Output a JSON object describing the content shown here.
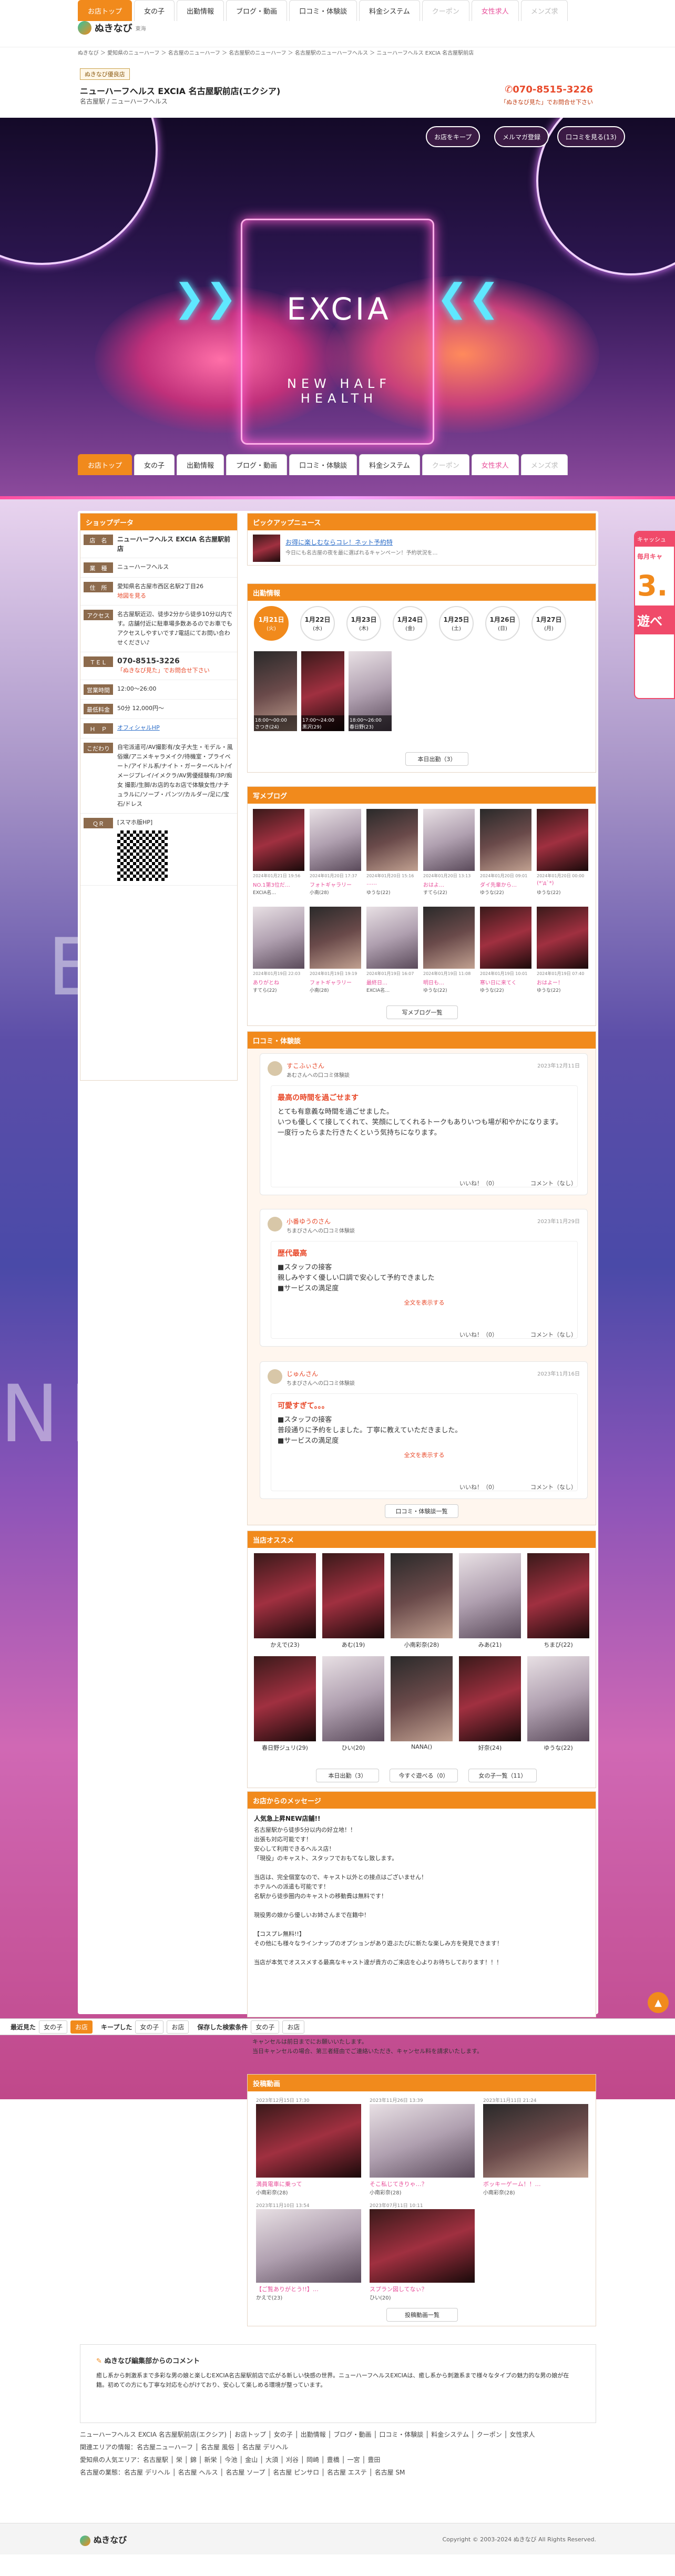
{
  "top_nav": {
    "tabs": [
      {
        "label": "お店トップ",
        "active": true
      },
      {
        "label": "女の子"
      },
      {
        "label": "出勤情報"
      },
      {
        "label": "ブログ・動画"
      },
      {
        "label": "口コミ・体験談"
      },
      {
        "label": "料金システム"
      },
      {
        "label": "クーポン",
        "dim": true
      },
      {
        "label": "女性求人",
        "pink": true
      },
      {
        "label": "メンズ求",
        "dim": true
      }
    ]
  },
  "site": {
    "logo": "ぬきなび",
    "area": "東海"
  },
  "breadcrumb": "ぬきなび ＞ 愛知県のニューハーフ ＞ 名古屋のニューハーフ ＞ 名古屋駅のニューハーフ ＞ 名古屋駅のニューハーフヘルス ＞ ニューハーフヘルス EXCIA 名古屋駅前店",
  "shop_header": {
    "badge": "ぬきなび優良店",
    "name": "ニューハーフヘルス EXCIA 名古屋駅前店(エクシア)",
    "sub": "名古屋駅 / ニューハーフヘルス",
    "phone": "070-8515-3226",
    "phone_note": "「ぬきなび見た」でお問合せ下さい"
  },
  "hero": {
    "logo": "EXCIA",
    "tagline": "NEW HALF HEALTH",
    "buttons": [
      "お店をキープ",
      "メルマガ登録",
      "口コミを見る(13)"
    ]
  },
  "shop_data": {
    "title": "ショップデータ",
    "rows": [
      {
        "label": "店　名",
        "value": "ニューハーフヘルス EXCIA 名古屋駅前店"
      },
      {
        "label": "業　種",
        "value": "ニューハーフヘルス"
      },
      {
        "label": "住　所",
        "value": "愛知県名古屋市西区名駅2丁目26"
      },
      {
        "label": "アクセス",
        "value": "名古屋駅近辺、徒歩2分から徒歩10分以内です。店舗付近に駐車場多数あるのでお車でもアクセスしやすいです♪電話にてお問い合わせください♪"
      },
      {
        "label": "ＴＥＬ",
        "value": "070-8515-3226"
      },
      {
        "label": "営業時間",
        "value": "12:00〜26:00"
      },
      {
        "label": "最低料金",
        "value": "50分 12,000円〜"
      },
      {
        "label": "Ｈ　Ｐ",
        "value": "オフィシャルHP"
      },
      {
        "label": "こだわり",
        "value": "自宅派遣可/AV撮影有/女子大生・モデル・風俗嬢/アニメキャラメイク/待機室・プライベート/アイドル系/ナイト・ガーターベルト/イメージプレイ/イメクラ/AV男優経験有/3P/痴女 撮影/生脚/お店的なお店で体験女性/ナチュラルに/ソープ・パンツ/カルダー/足に/宝石/ドレス"
      },
      {
        "label": "ＱＲ",
        "value": "[スマホ版HP]"
      }
    ],
    "map_link": "地図を見る",
    "phone_hint": "「ぬきなび見た」でお問合せ下さい"
  },
  "pickup": {
    "title": "ピックアップニュース",
    "text": "お得に楽しむならコレ！ネット予約特",
    "sub": "今日にも名古屋の夜を最に選ばれるキャンペーン！予約状況を…"
  },
  "schedule": {
    "title": "出勤情報",
    "dates": [
      {
        "day": "1月21日",
        "week": "(火)",
        "on": true
      },
      {
        "day": "1月22日",
        "week": "(水)"
      },
      {
        "day": "1月23日",
        "week": "(木)"
      },
      {
        "day": "1月24日",
        "week": "(金)"
      },
      {
        "day": "1月25日",
        "week": "(土)"
      },
      {
        "day": "1月26日",
        "week": "(日)"
      },
      {
        "day": "1月27日",
        "week": "(月)"
      }
    ],
    "cards": [
      {
        "time": "18:00〜00:00",
        "name": "さつき(24)"
      },
      {
        "time": "17:00〜24:00",
        "name": "黒沢(29)"
      },
      {
        "time": "18:00〜26:00",
        "name": "春日野(23)"
      }
    ],
    "more": "本日出勤（3）"
  },
  "blog": {
    "title": "写メブログ",
    "posts": [
      {
        "date": "2024年01月21日 19:56",
        "title": "NO.1第3位だ…",
        "author": "EXCIA名…"
      },
      {
        "date": "2024年01月20日 17:37",
        "title": "フォトギャラリー",
        "author": "小南(28) "
      },
      {
        "date": "2024年01月20日 15:16",
        "title": "……",
        "author": "ゆうな(22)"
      },
      {
        "date": "2024年01月20日 13:13",
        "title": "おはよ…",
        "author": "すてら(22)"
      },
      {
        "date": "2024年01月20日 09:01",
        "title": "ダイ先輩から…",
        "author": "ゆうな(22)"
      },
      {
        "date": "2024年01月20日 00:00",
        "title": "(*'д`*)",
        "author": "ゆうな(22)"
      },
      {
        "date": "2024年01月19日 22:03",
        "title": "ありがとね",
        "author": "すてら(22)"
      },
      {
        "date": "2024年01月19日 19:19",
        "title": "フォトギャラリー",
        "author": "小南(28)"
      },
      {
        "date": "2024年01月19日 16:07",
        "title": "最終日…",
        "author": "EXCIA名…"
      },
      {
        "date": "2024年01月19日 11:08",
        "title": "明日も…",
        "author": "ゆうな(22)"
      },
      {
        "date": "2024年01月19日 10:01",
        "title": "寒い日に来てく",
        "author": "ゆうな(22)"
      },
      {
        "date": "2024年01月19日 07:40",
        "title": "おはよー！",
        "author": "ゆうな(22)"
      }
    ],
    "more": "写メブログ一覧"
  },
  "reviews": {
    "title": "口コミ・体験談",
    "items": [
      {
        "user": "すこふぃさん",
        "target": "あむさんへの口コミ体験談",
        "date": "2023年12月11日",
        "heading": "最高の時間を過ごせます",
        "body": "とても有意義な時間を過ごせました。\nいつも優しくて接してくれて、笑顔にしてくれるトークもありいつも場が和やかになります。\n一度行ったらまた行きたくという気持ちになります。",
        "like": "いいね！（0）",
        "comment": "コメント（なし）"
      },
      {
        "user": "小番ゆうのさん",
        "target": "ちまびさんへの口コミ体験談",
        "date": "2023年11月29日",
        "heading": "歴代最高",
        "body": "■スタッフの接客\n親しみやすく優しい口調で安心して予約できました\n■サービスの満足度",
        "more": "全文を表示する",
        "like": "いいね！（0）",
        "comment": "コメント（なし）"
      },
      {
        "user": "じゅんさん",
        "target": "ちまびさんへの口コミ体験談",
        "date": "2023年11月16日",
        "heading": "可愛すぎて。。。",
        "body": "■スタッフの接客\n普段通りに予約をしました。丁寧に教えていただきました。\n■サービスの満足度",
        "more": "全文を表示する",
        "like": "いいね！（0）",
        "comment": "コメント（なし）"
      }
    ],
    "more": "口コミ・体験談一覧"
  },
  "recommend": {
    "title": "当店オススメ",
    "girls": [
      "かえで(23)",
      "あむ(19)",
      "小南彩奈(28)",
      "みあ(21)",
      "ちまび(22)",
      "春日野ジュリ(29)",
      "ひい(20)",
      "NANA()",
      "好奈(24)",
      "ゆうな(22)"
    ],
    "buttons": [
      "本日出勤（3）",
      "今すぐ遊べる（0）",
      "女の子一覧（11）"
    ]
  },
  "message": {
    "title": "お店からのメッセージ",
    "heading": "人気急上昇NEW店舗!!",
    "body": "名古屋駅から徒歩5分以内の好立地！！\n出張も対応可能です！\n安心して利用できるヘルス店！\n「現役」のキャスト、スタッフでおもてなし致します。\n\n当店は、完全個室なので、キャスト以外との接点はございません！\nホテルへの派遣も可能です！\n名駅から徒歩圏内のキャストの移動費は無料です！\n\n現役男の娘から優しいお姉さんまで在籍中！\n\n【コスプレ無料!!】\nその他にも様々なラインナップのオプションがあり遊ぶたびに新たな楽しみ方を発見できます！\n\n当店が本気でオススメする最高なキャスト達が貴方のご来店を心よりお待ちしております！！！",
    "tail": "キャンセルは前日までにお願いいたします。\n当日キャンセルの場合、第三者経由でご連絡いただき、キャンセル料を請求いたします。"
  },
  "video": {
    "title": "投稿動画",
    "posts": [
      {
        "date": "2023年12月15日 17:30",
        "title": "満員電車に乗って",
        "author": "小南彩奈(28)"
      },
      {
        "date": "2023年11月26日 13:39",
        "title": "そこ私じてきりゃ…？",
        "author": "小南彩奈(28)"
      },
      {
        "date": "2023年11月11日 21:24",
        "title": "ボッキーゲーム！！…",
        "author": "小南彩奈(28)"
      },
      {
        "date": "2023年11月10日 13:54",
        "title": "【ご覧ありがとう!!】…",
        "author": "かえで(23)"
      },
      {
        "date": "2023年07月11日 10:11",
        "title": "スプラン図してなぃ？",
        "author": "ひい(20)"
      }
    ],
    "more": "投稿動画一覧"
  },
  "editor_comment": {
    "title": "ぬきなび編集部からのコメント",
    "body": "癒し系から刺激系まで多彩な男の娘と楽しむEXCIA名古屋駅前店で広がる新しい快感の世界。ニューハーフヘルスEXCIAは、癒し系から刺激系まで様々なタイプの魅力的な男の娘が在籍。初めての方にも丁寧な対応を心がけており、安心して楽しめる環境が整っています。"
  },
  "bottom_bar": {
    "items": [
      "最近見た",
      "女の子",
      "お店",
      "キープした",
      "女の子",
      "お店",
      "保存した検索条件",
      "女の子",
      "お店"
    ]
  },
  "footer": {
    "line1": "ニューハーフヘルス EXCIA 名古屋駅前店(エクシア) │ お店トップ │ 女の子 │ 出勤情報 │ ブログ・動画 │ 口コミ・体験談 │ 料金システム │ クーポン │ 女性求人",
    "line2": "関連エリアの情報：名古屋ニューハーフ │ 名古屋 風俗 │ 名古屋 デリヘル",
    "line3": "愛知県の人気エリア：名古屋駅 │ 栄 │ 錦 │ 新栄 │ 今池 │ 金山 │ 大須 │ 刈谷 │ 岡崎 │ 豊橋 │ 一宮 │ 豊田",
    "line4": "名古屋の業態：名古屋 デリヘル │ 名古屋 ヘルス │ 名古屋 ソープ │ 名古屋 ピンサロ │ 名古屋 エステ │ 名古屋 SM",
    "logo": "ぬきなび",
    "copyright": "Copyright © 2003-2024 ぬきなび All Rights Reserved."
  },
  "side_banner": {
    "line1": "キャッシュ",
    "line2": "毎月キャ",
    "line3": "3.",
    "line4": "遊べ"
  }
}
